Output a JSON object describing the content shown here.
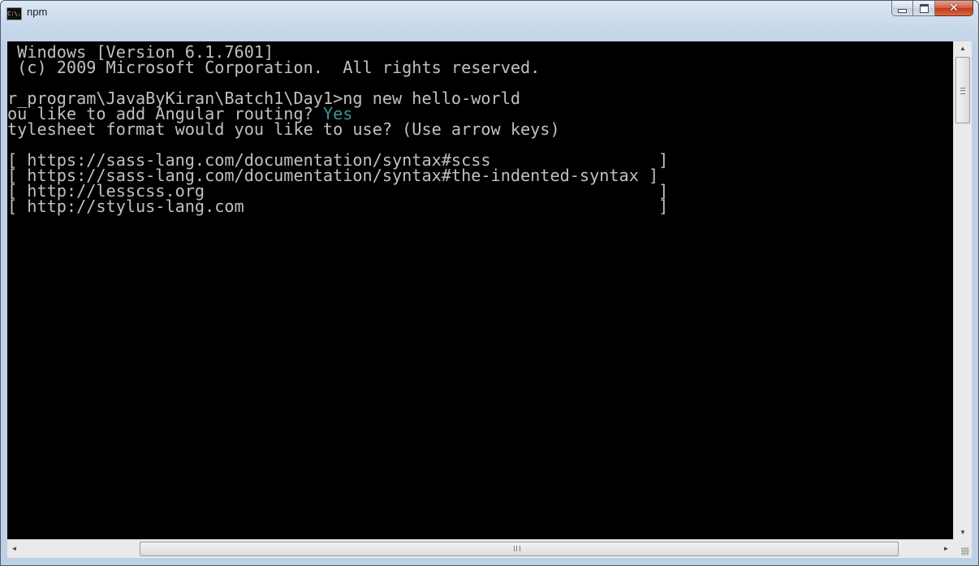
{
  "window": {
    "title": "npm",
    "icon": "cmd-console-icon",
    "icon_text": "C:\\."
  },
  "caption_buttons": {
    "minimize": "minimize-icon",
    "maximize": "maximize-icon",
    "close": "close-icon"
  },
  "console": {
    "lines": [
      " Windows [Version 6.1.7601]",
      " (c) 2009 Microsoft Corporation.  All rights reserved.",
      "",
      "r_program\\JavaByKiran\\Batch1\\Day1>ng new hello-world",
      "ou like to add Angular routing? ",
      "tylesheet format would you like to use? (Use arrow keys)",
      "",
      "[ https://sass-lang.com/documentation/syntax#scss                 ]",
      "[ https://sass-lang.com/documentation/syntax#the-indented-syntax ]",
      "[ http://lesscss.org                                              ]",
      "[ http://stylus-lang.com                                          ]"
    ],
    "answer": "Yes",
    "colors": {
      "background": "#000000",
      "text": "#c0c0c0",
      "answer": "#3a9696"
    }
  },
  "scrollbars": {
    "up_arrow": "▲",
    "down_arrow": "▼",
    "left_arrow": "◄",
    "right_arrow": "►"
  }
}
